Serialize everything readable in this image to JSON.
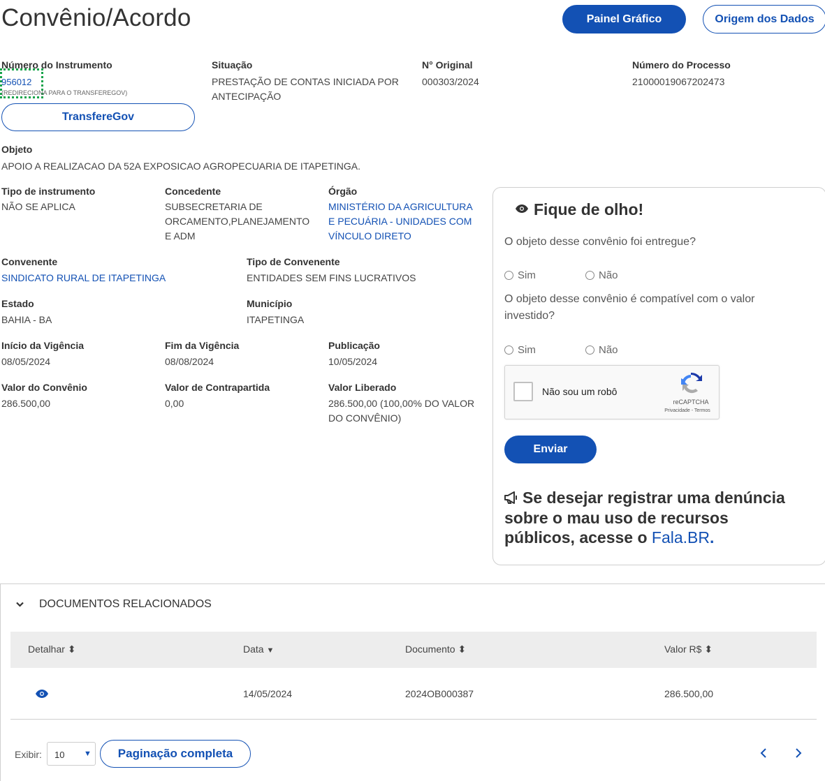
{
  "header": {
    "title": "Convênio/Acordo",
    "btn_painel": "Painel Gráfico",
    "btn_origem": "Origem dos Dados"
  },
  "instrumento": {
    "label": "Número do Instrumento",
    "value": "956012",
    "note": "(REDIRECIONA PARA O TRANSFEREGOV)",
    "btn_transferegov": "TransfereGov"
  },
  "situacao": {
    "label": "Situação",
    "line1": "PRESTAÇÃO DE CONTAS INICIADA POR",
    "line2": "ANTECIPAÇÃO"
  },
  "n_original": {
    "label": "N° Original",
    "value": "000303/2024"
  },
  "processo": {
    "label": "Número do Processo",
    "value": "21000019067202473"
  },
  "objeto": {
    "label": "Objeto",
    "value": "APOIO A REALIZACAO DA 52A EXPOSICAO AGROPECUARIA DE ITAPETINGA."
  },
  "tipo_instrumento": {
    "label": "Tipo de instrumento",
    "value": "NÃO SE APLICA"
  },
  "concedente": {
    "label": "Concedente",
    "line1": "SUBSECRETARIA DE",
    "line2": "ORCAMENTO,PLANEJAMENTO",
    "line3": "E ADM"
  },
  "orgao": {
    "label": "Órgão",
    "line1": "MINISTÉRIO DA AGRICULTURA",
    "line2": "E PECUÁRIA - UNIDADES COM",
    "line3": "VÍNCULO DIRETO"
  },
  "convenente": {
    "label": "Convenente",
    "value": "SINDICATO RURAL DE ITAPETINGA"
  },
  "tipo_convenente": {
    "label": "Tipo de Convenente",
    "value": "ENTIDADES SEM FINS LUCRATIVOS"
  },
  "estado": {
    "label": "Estado",
    "value": "BAHIA - BA"
  },
  "municipio": {
    "label": "Município",
    "value": "ITAPETINGA"
  },
  "inicio": {
    "label": "Início da Vigência",
    "value": "08/05/2024"
  },
  "fim": {
    "label": "Fim da Vigência",
    "value": "08/08/2024"
  },
  "publicacao": {
    "label": "Publicação",
    "value": "10/05/2024"
  },
  "valor_convenio": {
    "label": "Valor do Convênio",
    "value": "286.500,00"
  },
  "contrapartida": {
    "label": "Valor de Contrapartida",
    "value": "0,00"
  },
  "liberado": {
    "label": "Valor Liberado",
    "line1": "286.500,00 (100,00% DO VALOR",
    "line2": "DO CONVÊNIO)"
  },
  "panel": {
    "title": "Fique de olho!",
    "q1": "O objeto desse convênio foi entregue?",
    "q2_line1": "O objeto desse convênio é compatível com o valor",
    "q2_line2": "investido?",
    "sim": "Sim",
    "nao": "Não",
    "captcha_label": "Não sou um robô",
    "captcha_brand": "reCAPTCHA",
    "captcha_links": "Privacidade - Termos",
    "btn_enviar": "Enviar",
    "denuncia_line1": "Se desejar registrar uma denúncia",
    "denuncia_line2": "sobre o mau uso de recursos",
    "denuncia_line3": "públicos, acesse o ",
    "denuncia_link": "Fala.BR",
    "denuncia_end": "."
  },
  "docs": {
    "title": "DOCUMENTOS RELACIONADOS",
    "columns": [
      "Detalhar",
      "Data",
      "Documento",
      "Valor R$"
    ],
    "rows": [
      {
        "data": "14/05/2024",
        "documento": "2024OB000387",
        "valor": "286.500,00"
      }
    ],
    "exibir_label": "Exibir:",
    "page_size": "10",
    "btn_paginacao": "Paginação completa"
  },
  "colors": {
    "primary": "#1351b4",
    "focus": "#17a34a"
  }
}
